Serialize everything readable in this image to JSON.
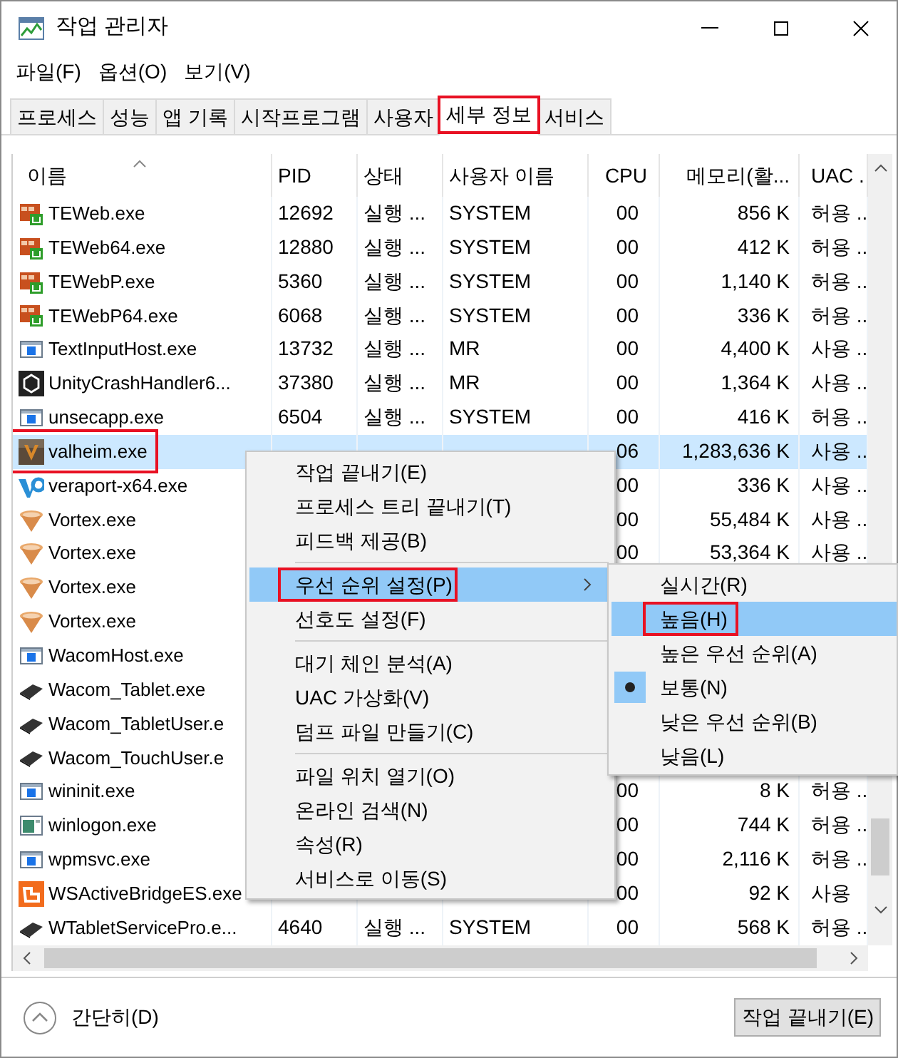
{
  "window": {
    "title": "작업 관리자"
  },
  "menu_bar": [
    "파일(F)",
    "옵션(O)",
    "보기(V)"
  ],
  "tabs": [
    {
      "label": "프로세스",
      "selected": false,
      "annotated": false
    },
    {
      "label": "성능",
      "selected": false,
      "annotated": false
    },
    {
      "label": "앱 기록",
      "selected": false,
      "annotated": false
    },
    {
      "label": "시작프로그램",
      "selected": false,
      "annotated": false
    },
    {
      "label": "사용자",
      "selected": false,
      "annotated": false
    },
    {
      "label": "세부 정보",
      "selected": true,
      "annotated": true
    },
    {
      "label": "서비스",
      "selected": false,
      "annotated": false
    }
  ],
  "table": {
    "columns": [
      "이름",
      "PID",
      "상태",
      "사용자 이름",
      "CPU",
      "메모리(활...",
      "UAC ."
    ],
    "rows": [
      {
        "kind": "nx",
        "name": "TEWeb.exe",
        "pid": "12692",
        "status": "실행 ...",
        "user": "SYSTEM",
        "cpu": "00",
        "memory": "856 K",
        "uac": "허용 ..",
        "selected": false,
        "annotated": false
      },
      {
        "kind": "nx",
        "name": "TEWeb64.exe",
        "pid": "12880",
        "status": "실행 ...",
        "user": "SYSTEM",
        "cpu": "00",
        "memory": "412 K",
        "uac": "허용 ..",
        "selected": false,
        "annotated": false
      },
      {
        "kind": "nx",
        "name": "TEWebP.exe",
        "pid": "5360",
        "status": "실행 ...",
        "user": "SYSTEM",
        "cpu": "00",
        "memory": "1,140 K",
        "uac": "허용 ..",
        "selected": false,
        "annotated": false
      },
      {
        "kind": "nx",
        "name": "TEWebP64.exe",
        "pid": "6068",
        "status": "실행 ...",
        "user": "SYSTEM",
        "cpu": "00",
        "memory": "336 K",
        "uac": "허용 ..",
        "selected": false,
        "annotated": false
      },
      {
        "kind": "window",
        "name": "TextInputHost.exe",
        "pid": "13732",
        "status": "실행 ...",
        "user": "MR",
        "cpu": "00",
        "memory": "4,400 K",
        "uac": "사용 ..",
        "selected": false,
        "annotated": false
      },
      {
        "kind": "unity",
        "name": "UnityCrashHandler6...",
        "pid": "37380",
        "status": "실행 ...",
        "user": "MR",
        "cpu": "00",
        "memory": "1,364 K",
        "uac": "사용 ..",
        "selected": false,
        "annotated": false
      },
      {
        "kind": "window",
        "name": "unsecapp.exe",
        "pid": "6504",
        "status": "실행 ...",
        "user": "SYSTEM",
        "cpu": "00",
        "memory": "416 K",
        "uac": "허용 ..",
        "selected": false,
        "annotated": false
      },
      {
        "kind": "valheim",
        "name": "valheim.exe",
        "cpu": "06",
        "memory": "1,283,636 K",
        "uac": "사용 ..",
        "selected": true,
        "annotated": true
      },
      {
        "kind": "vp",
        "name": "veraport-x64.exe",
        "cpu": "00",
        "memory": "336 K",
        "uac": "사용 ..",
        "selected": false,
        "annotated": false
      },
      {
        "kind": "vortex",
        "name": "Vortex.exe",
        "cpu": "00",
        "memory": "55,484 K",
        "uac": "사용 ..",
        "selected": false,
        "annotated": false
      },
      {
        "kind": "vortex",
        "name": "Vortex.exe",
        "cpu": "00",
        "memory": "53,364 K",
        "uac": "사용 ..",
        "selected": false,
        "annotated": false
      },
      {
        "kind": "vortex",
        "name": "Vortex.exe",
        "selected": false,
        "annotated": false
      },
      {
        "kind": "vortex",
        "name": "Vortex.exe",
        "selected": false,
        "annotated": false
      },
      {
        "kind": "window",
        "name": "WacomHost.exe",
        "selected": false,
        "annotated": false
      },
      {
        "kind": "tablet",
        "name": "Wacom_Tablet.exe",
        "selected": false,
        "annotated": false
      },
      {
        "kind": "tablet",
        "name": "Wacom_TabletUser.e",
        "selected": false,
        "annotated": false
      },
      {
        "kind": "tablet",
        "name": "Wacom_TouchUser.e",
        "selected": false,
        "annotated": false
      },
      {
        "kind": "window",
        "name": "wininit.exe",
        "cpu": "00",
        "memory": "8 K",
        "uac": "허용 ..",
        "selected": false,
        "annotated": false
      },
      {
        "kind": "winlogon",
        "name": "winlogon.exe",
        "cpu": "00",
        "memory": "744 K",
        "uac": "허용 ..",
        "selected": false,
        "annotated": false
      },
      {
        "kind": "window",
        "name": "wpmsvc.exe",
        "cpu": "00",
        "memory": "2,116 K",
        "uac": "허용 ..",
        "selected": false,
        "annotated": false
      },
      {
        "kind": "ws",
        "name": "WSActiveBridgeES.exe",
        "cpu": "00",
        "memory": "92 K",
        "uac": "사용",
        "selected": false,
        "annotated": false
      },
      {
        "kind": "tablet",
        "name": "WTabletServicePro.e...",
        "pid": "4640",
        "status": "실행 ...",
        "user": "SYSTEM",
        "cpu": "00",
        "memory": "568 K",
        "uac": "허용 ..",
        "selected": false,
        "annotated": false
      }
    ]
  },
  "context_menu": {
    "items": [
      {
        "kind": "item",
        "label": "작업 끝내기(E)",
        "selected": false,
        "annotated": false,
        "submenu": false
      },
      {
        "kind": "item",
        "label": "프로세스 트리 끝내기(T)",
        "selected": false,
        "annotated": false,
        "submenu": false
      },
      {
        "kind": "item",
        "label": "피드백 제공(B)",
        "selected": false,
        "annotated": false,
        "submenu": false
      },
      {
        "kind": "separator"
      },
      {
        "kind": "item",
        "label": "우선 순위 설정(P)",
        "selected": true,
        "annotated": true,
        "submenu": true
      },
      {
        "kind": "item",
        "label": "선호도 설정(F)",
        "selected": false,
        "annotated": false,
        "submenu": false
      },
      {
        "kind": "separator"
      },
      {
        "kind": "item",
        "label": "대기 체인 분석(A)",
        "selected": false,
        "annotated": false,
        "submenu": false
      },
      {
        "kind": "item",
        "label": "UAC 가상화(V)",
        "selected": false,
        "annotated": false,
        "submenu": false
      },
      {
        "kind": "item",
        "label": "덤프 파일 만들기(C)",
        "selected": false,
        "annotated": false,
        "submenu": false
      },
      {
        "kind": "separator"
      },
      {
        "kind": "item",
        "label": "파일 위치 열기(O)",
        "selected": false,
        "annotated": false,
        "submenu": false
      },
      {
        "kind": "item",
        "label": "온라인 검색(N)",
        "selected": false,
        "annotated": false,
        "submenu": false
      },
      {
        "kind": "item",
        "label": "속성(R)",
        "selected": false,
        "annotated": false,
        "submenu": false
      },
      {
        "kind": "item",
        "label": "서비스로 이동(S)",
        "selected": false,
        "annotated": false,
        "submenu": false
      }
    ]
  },
  "priority_submenu": {
    "items": [
      {
        "label": "실시간(R)",
        "selected": false,
        "checked": false,
        "annotated": false
      },
      {
        "label": "높음(H)",
        "selected": true,
        "checked": false,
        "annotated": true
      },
      {
        "label": "높은 우선 순위(A)",
        "selected": false,
        "checked": false,
        "annotated": false
      },
      {
        "label": "보통(N)",
        "selected": false,
        "checked": true,
        "annotated": false
      },
      {
        "label": "낮은 우선 순위(B)",
        "selected": false,
        "checked": false,
        "annotated": false
      },
      {
        "label": "낮음(L)",
        "selected": false,
        "checked": false,
        "annotated": false
      }
    ]
  },
  "footer": {
    "toggle_label": "간단히(D)",
    "button": "작업 끝내기(E)"
  }
}
